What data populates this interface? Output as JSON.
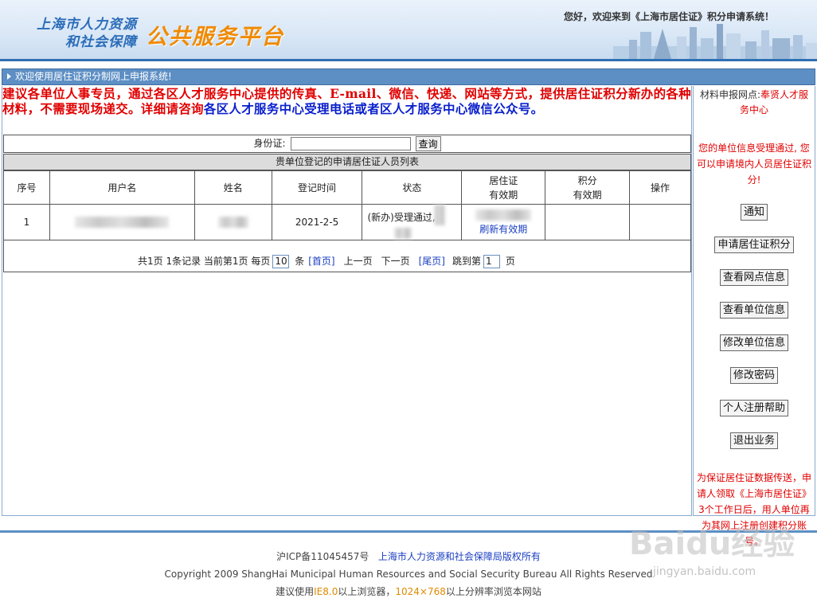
{
  "header": {
    "org_line1": "上海市人力资源",
    "org_line2": "和社会保障",
    "platform": "公共服务平台",
    "welcome": "您好，欢迎来到《上海市居住证》积分申请系统！"
  },
  "titlebar": {
    "text": "欢迎使用居住证积分制网上申报系统!"
  },
  "notice": {
    "red": "建议各单位人事专员，通过各区人才服务中心提供的传真、E-mail、微信、快递、网站等方式，提供居住证积分新办的各种材料，不需要现场递交。详细请咨询",
    "blue": "各区人才服务中心受理电话或者区人才服务中心微信公众号。"
  },
  "search": {
    "label": "身份证:",
    "value": "",
    "button": "查询"
  },
  "list_caption": "贵单位登记的申请居住证人员列表",
  "table": {
    "headers": [
      "序号",
      "用户名",
      "姓名",
      "登记时间",
      "状态",
      "居住证",
      "有效期",
      "积分",
      "有效期",
      "操作"
    ],
    "row": {
      "index": "1",
      "date": "2021-2-5",
      "status": "(新办)受理通过,",
      "refresh": "刷新有效期"
    }
  },
  "pager": {
    "summary": "共1页 1条记录 当前第1页 每页",
    "per_page": "10",
    "unit": "条",
    "first": "[首页]",
    "prev": "上一页",
    "next": "下一页",
    "last": "[尾页]",
    "goto": "跳到第",
    "page": "1",
    "page_unit": "页"
  },
  "sidebar": {
    "site_label": "材料申报网点:",
    "site_name": "奉贤人才服务中心",
    "ok_text": "您的单位信息受理通过, 您可以申请境内人员居住证积分!",
    "buttons": [
      "通知",
      "申请居住证积分",
      "查看网点信息",
      "查看单位信息",
      "修改单位信息",
      "修改密码",
      "个人注册帮助",
      "退出业务"
    ],
    "tip": "为保证居住证数据传送，申请人领取《上海市居住证》3个工作日后，用人单位再为其网上注册创建积分账号。"
  },
  "footer": {
    "icp": "沪ICP备11045457号",
    "owner": "上海市人力资源和社会保障局版权所有",
    "copyright": "Copyright 2009 ShangHai Municipal Human Resources and Social Security Bureau All Rights Reserved",
    "tip_pre": "建议使用",
    "tip_ie": "IE8.0",
    "tip_mid": "以上浏览器，",
    "tip_res": "1024×768",
    "tip_post": "以上分辨率浏览本网站"
  },
  "watermark": {
    "logo": "Baidu经验",
    "url": "jingyan.baidu.com"
  }
}
